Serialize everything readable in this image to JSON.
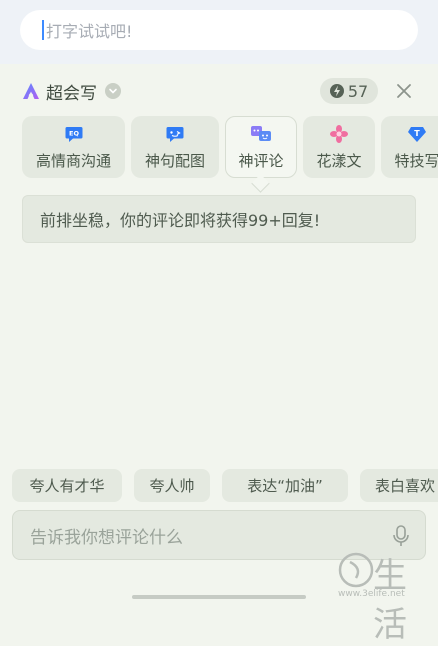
{
  "top_input": {
    "placeholder": "打字试试吧!"
  },
  "panel": {
    "title": "超会写",
    "points": "57"
  },
  "tools": [
    {
      "label": "高情商沟通",
      "icon": "eq-icon"
    },
    {
      "label": "神句配图",
      "icon": "chat-face-icon"
    },
    {
      "label": "神评论",
      "icon": "comment-faces-icon",
      "selected": true
    },
    {
      "label": "花漾文",
      "icon": "flower-icon"
    },
    {
      "label": "特技写",
      "icon": "diamond-t-icon"
    }
  ],
  "suggestion": "前排坐稳，你的评论即将获得99+回复!",
  "quick_chips": [
    "夸人有才华",
    "夸人帅",
    "表达“加油”",
    "表白喜欢"
  ],
  "bottom_input": {
    "placeholder": "告诉我你想评论什么"
  },
  "watermark": {
    "text": "生活",
    "url": "www.3elife.net"
  },
  "colors": {
    "background": "#f2f5ee",
    "chip": "#e4e9e0",
    "accent_blue": "#3d8bff",
    "flower_pink": "#f06ea0",
    "purple": "#7a6cf0"
  }
}
